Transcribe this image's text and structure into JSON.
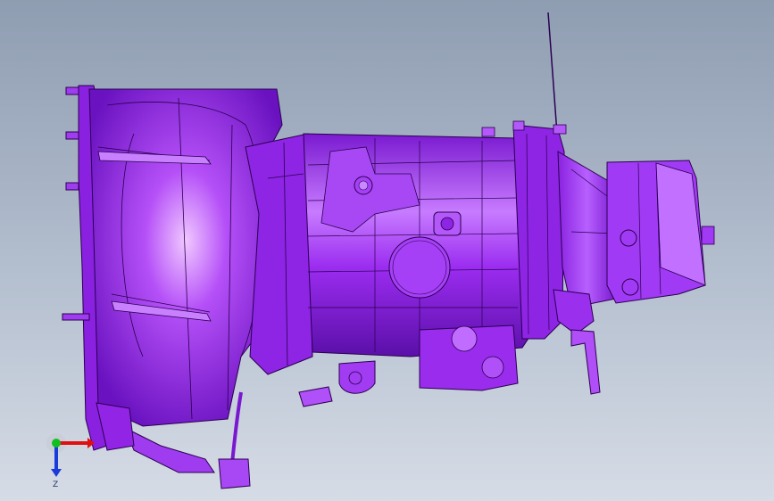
{
  "viewport": {
    "background_top": "#8f9db2",
    "background_bottom": "#d6dce6"
  },
  "model": {
    "fill_color": "#9b2cf0",
    "highlight_color": "#e7b8ff",
    "shadow_color": "#5a0fa8",
    "edge_color": "#2a0050"
  },
  "triad": {
    "x_color": "#e01010",
    "y_color": "#10c020",
    "z_color": "#1a3cd8",
    "z_label": "Z"
  }
}
